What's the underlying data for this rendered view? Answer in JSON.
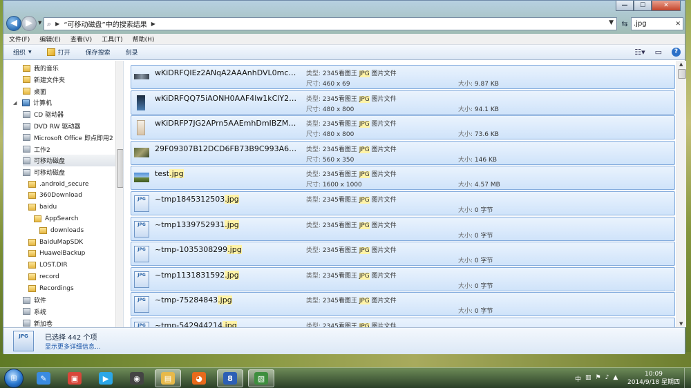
{
  "window": {
    "address": {
      "path": "“可移动磁盘”中的搜索结果",
      "search_value": ".jpg"
    },
    "controls": {
      "minimize": "—",
      "maximize": "☐",
      "close": "✕"
    }
  },
  "menubar": {
    "items": [
      "文件(F)",
      "编辑(E)",
      "查看(V)",
      "工具(T)",
      "帮助(H)"
    ]
  },
  "toolbar": {
    "organize": "组织",
    "open": "打开",
    "save_search": "保存搜索",
    "burn": "刻录"
  },
  "navpane": {
    "items": [
      {
        "label": "我的音乐",
        "icon": "music-folder-icon",
        "indent": 1
      },
      {
        "label": "新建文件夹",
        "icon": "folder-icon",
        "indent": 1
      },
      {
        "label": "桌面",
        "icon": "desktop-folder-icon",
        "indent": 1
      },
      {
        "label": "计算机",
        "icon": "computer-icon",
        "indent": 0,
        "caret": "◢"
      },
      {
        "label": "CD 驱动器",
        "icon": "cd-drive-icon",
        "indent": 1
      },
      {
        "label": "DVD RW 驱动器",
        "icon": "dvd-drive-icon",
        "indent": 1
      },
      {
        "label": "Microsoft Office 即点即用2",
        "icon": "drive-icon",
        "indent": 1
      },
      {
        "label": "工作2",
        "icon": "drive-icon",
        "indent": 1
      },
      {
        "label": "可移动磁盘",
        "icon": "usb-drive-icon",
        "indent": 1,
        "selected": true
      },
      {
        "label": "可移动磁盘",
        "icon": "usb-drive-icon",
        "indent": 1
      },
      {
        "label": ".android_secure",
        "icon": "folder-icon",
        "indent": 2
      },
      {
        "label": "360Download",
        "icon": "folder-icon",
        "indent": 2
      },
      {
        "label": "baidu",
        "icon": "folder-icon",
        "indent": 2
      },
      {
        "label": "AppSearch",
        "icon": "folder-icon",
        "indent": 3
      },
      {
        "label": "downloads",
        "icon": "folder-icon",
        "indent": 4
      },
      {
        "label": "BaiduMapSDK",
        "icon": "folder-icon",
        "indent": 2
      },
      {
        "label": "HuaweiBackup",
        "icon": "folder-icon",
        "indent": 2
      },
      {
        "label": "LOST.DIR",
        "icon": "folder-icon",
        "indent": 2
      },
      {
        "label": "record",
        "icon": "folder-icon",
        "indent": 2
      },
      {
        "label": "Recordings",
        "icon": "folder-icon",
        "indent": 2
      },
      {
        "label": "软件",
        "icon": "drive-icon",
        "indent": 1
      },
      {
        "label": "系统",
        "icon": "drive-icon",
        "indent": 1
      },
      {
        "label": "新加卷",
        "icon": "drive-icon",
        "indent": 1
      }
    ]
  },
  "files": {
    "type_label": "类型:",
    "dims_label": "尺寸:",
    "size_label": "大小:",
    "items": [
      {
        "name": "wKiDRFQIEz2ANqA2AAAnhDVL0mc5...",
        "name_hl": "",
        "type_pre": "2345看图王 ",
        "type_hl": "JPG",
        "type_post": " 图片文件",
        "dims": "460 x 69",
        "size": "9.87 KB",
        "thumb": "banner-thumb-icon"
      },
      {
        "name": "wKiDRFQQ75iAONH0AAF4lw1kClY29...",
        "name_hl": "",
        "type_pre": "2345看图王 ",
        "type_hl": "JPG",
        "type_post": " 图片文件",
        "dims": "480 x 800",
        "size": "94.1 KB",
        "thumb": "phone-thumb-icon"
      },
      {
        "name": "wKiDRFP7JG2APrn5AAEmhDmIBZM2...",
        "name_hl": "",
        "type_pre": "2345看图王 ",
        "type_hl": "JPG",
        "type_post": " 图片文件",
        "dims": "480 x 800",
        "size": "73.6 KB",
        "thumb": "portrait-thumb-icon"
      },
      {
        "name": "29F09307B12DCD6FB73B9C993A691...",
        "name_hl": "",
        "type_pre": "2345看图王 ",
        "type_hl": "JPG",
        "type_post": " 图片文件",
        "dims": "560 x 350",
        "size": "146 KB",
        "thumb": "photo-thumb-icon"
      },
      {
        "name": "test",
        "name_hl": ".jpg",
        "type_pre": "2345看图王 ",
        "type_hl": "JPG",
        "type_post": " 图片文件",
        "dims": "1600 x 1000",
        "size": "4.57 MB",
        "thumb": "landscape-thumb-icon"
      },
      {
        "name": "~tmp1845312503",
        "name_hl": ".jpg",
        "type_pre": "2345看图王 ",
        "type_hl": "JPG",
        "type_post": " 图片文件",
        "dims": "",
        "size": "0 字节",
        "thumb": "jpg-file-icon"
      },
      {
        "name": "~tmp1339752931",
        "name_hl": ".jpg",
        "type_pre": "2345看图王 ",
        "type_hl": "JPG",
        "type_post": " 图片文件",
        "dims": "",
        "size": "0 字节",
        "thumb": "jpg-file-icon"
      },
      {
        "name": "~tmp-1035308299",
        "name_hl": ".jpg",
        "type_pre": "2345看图王 ",
        "type_hl": "JPG",
        "type_post": " 图片文件",
        "dims": "",
        "size": "0 字节",
        "thumb": "jpg-file-icon"
      },
      {
        "name": "~tmp1131831592",
        "name_hl": ".jpg",
        "type_pre": "2345看图王 ",
        "type_hl": "JPG",
        "type_post": " 图片文件",
        "dims": "",
        "size": "0 字节",
        "thumb": "jpg-file-icon"
      },
      {
        "name": "~tmp-75284843",
        "name_hl": ".jpg",
        "type_pre": "2345看图王 ",
        "type_hl": "JPG",
        "type_post": " 图片文件",
        "dims": "",
        "size": "0 字节",
        "thumb": "jpg-file-icon"
      },
      {
        "name": "~tmp-542944214",
        "name_hl": ".jpg",
        "type_pre": "2345看图王 ",
        "type_hl": "JPG",
        "type_post": " 图片文件",
        "dims": "",
        "size": "",
        "thumb": "jpg-file-icon"
      }
    ]
  },
  "details": {
    "selected_count": "已选择 442 个项",
    "more_link": "显示更多详细信息...",
    "icon_text": "JPG"
  },
  "taskbar": {
    "apps": [
      {
        "name": "wps-icon",
        "glyph": "✎",
        "color": "#3a8be0"
      },
      {
        "name": "media-center-icon",
        "glyph": "▣",
        "color": "#d9463a"
      },
      {
        "name": "video-player-icon",
        "glyph": "▶",
        "color": "#2ba7e8"
      },
      {
        "name": "camera-app-icon",
        "glyph": "◉",
        "color": "#444444"
      },
      {
        "name": "file-explorer-icon",
        "glyph": "▤",
        "color": "#e7b94a",
        "active": true
      },
      {
        "name": "firefox-icon",
        "glyph": "◕",
        "color": "#e86a1c"
      },
      {
        "name": "viewer-app-icon",
        "glyph": "8",
        "color": "#2d5fb5",
        "active": true
      },
      {
        "name": "remote-desktop-icon",
        "glyph": "▧",
        "color": "#3e8e3e",
        "active": true
      }
    ],
    "clock_time": "10:09",
    "clock_date": "2014/9/18 星期四"
  }
}
